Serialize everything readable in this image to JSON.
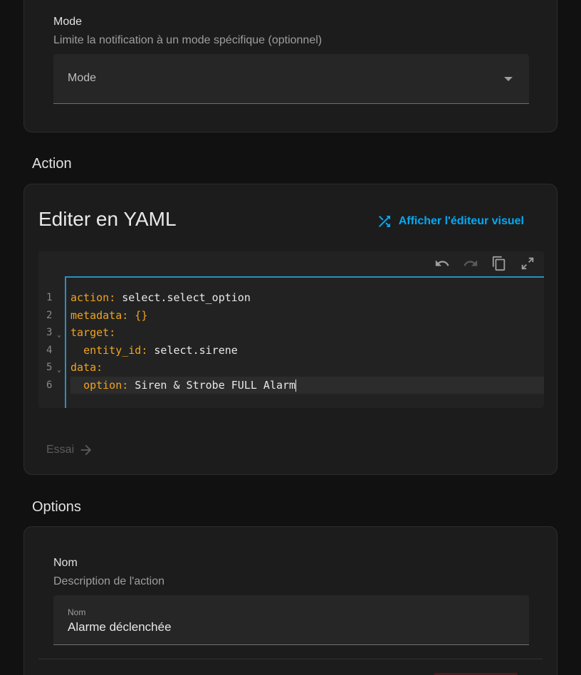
{
  "mode_field": {
    "title": "Mode",
    "description": "Limite la notification à un mode spécifique (optionnel)",
    "select_label": "Mode"
  },
  "action_section": {
    "heading": "Action",
    "card_title": "Editer en YAML",
    "visual_editor_label": "Afficher l'éditeur visuel",
    "run_label": "Essai"
  },
  "code": {
    "line_numbers": [
      "1",
      "2",
      "3",
      "4",
      "5",
      "6"
    ],
    "lines": [
      {
        "key": "action",
        "value": " select.select_option"
      },
      {
        "key": "metadata",
        "value": " {}"
      },
      {
        "key": "target",
        "value": ""
      },
      {
        "indent": "  ",
        "key": "entity_id",
        "value": " select.sirene"
      },
      {
        "key": "data",
        "value": ""
      },
      {
        "indent": "  ",
        "key": "option",
        "value": " Siren & Strobe FULL Alarm"
      }
    ]
  },
  "options_section": {
    "heading": "Options",
    "name_title": "Nom",
    "name_description": "Description de l'action",
    "name_field_label": "Nom",
    "name_field_value": "Alarme déclenchée"
  },
  "colors": {
    "accent": "#03a9f4",
    "yaml_key": "#f0a31e",
    "background": "#111111",
    "card": "#1c1c1c"
  }
}
